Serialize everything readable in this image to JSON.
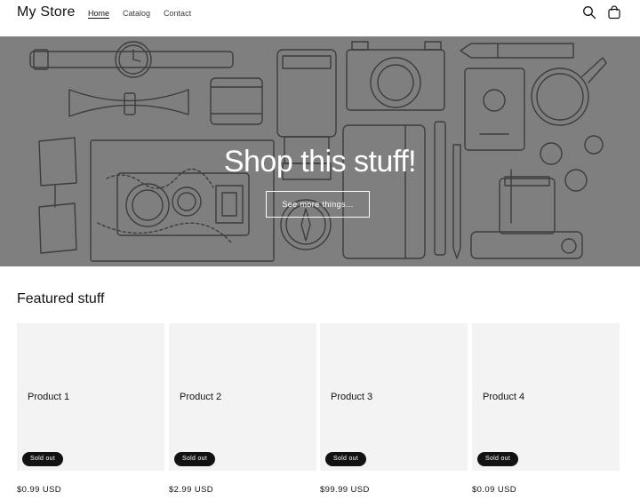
{
  "header": {
    "logo": "My Store",
    "nav": [
      "Home",
      "Catalog",
      "Contact"
    ],
    "active_nav": "Home",
    "icons": [
      "search-icon",
      "cart-icon"
    ]
  },
  "hero": {
    "title": "Shop this stuff!",
    "button_label": "See more things...",
    "background_color": "#7f7f7f"
  },
  "featured": {
    "title": "Featured stuff",
    "products": [
      {
        "name": "Product 1",
        "badge": "Sold out",
        "price": "$0.99 USD"
      },
      {
        "name": "Product 2",
        "badge": "Sold out",
        "price": "$2.99 USD"
      },
      {
        "name": "Product 3",
        "badge": "Sold out",
        "price": "$99.99 USD"
      },
      {
        "name": "Product 4",
        "badge": "Sold out",
        "price": "$0.09 USD"
      }
    ]
  },
  "colors": {
    "text": "#121212",
    "card_bg": "#f3f3f3",
    "badge_bg": "#121212"
  }
}
